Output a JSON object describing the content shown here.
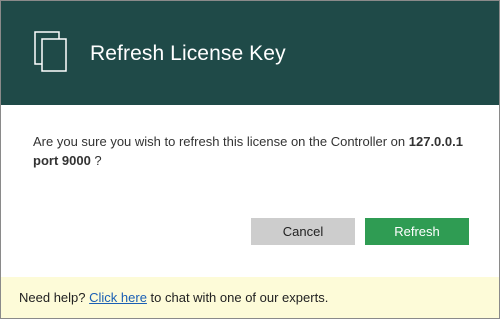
{
  "dialog": {
    "title": "Refresh License Key",
    "icon": "documents-icon",
    "message": {
      "prefix": "Are you sure you wish to refresh this license on the Controller on ",
      "host": "127.0.0.1",
      "line_break_part": "port 9000",
      "suffix": " ?"
    },
    "buttons": {
      "cancel_label": "Cancel",
      "refresh_label": "Refresh"
    }
  },
  "footer": {
    "prefix": "Need help? ",
    "link_label": "Click here",
    "suffix": " to chat with one of our experts."
  },
  "colors": {
    "header_bg": "#1f4a48",
    "refresh_button": "#2f9c53",
    "cancel_button": "#cdcdcd",
    "footer_bg": "#fdfbd8",
    "link": "#1a5fb4"
  }
}
